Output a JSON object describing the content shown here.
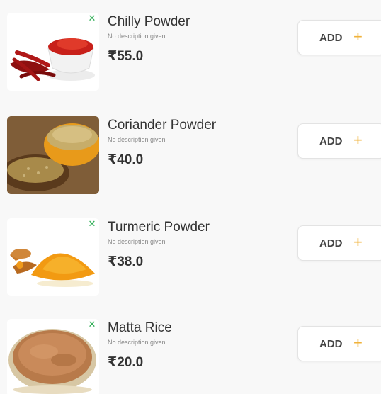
{
  "products": [
    {
      "name": "Chilly Powder",
      "description": "No description given",
      "price": "₹55.0",
      "add_label": "ADD",
      "add_icon": "plus-icon",
      "veg_icon": "veg-indicator-icon"
    },
    {
      "name": "Coriander Powder",
      "description": "No description given",
      "price": "₹40.0",
      "add_label": "ADD",
      "add_icon": "plus-icon"
    },
    {
      "name": "Turmeric Powder",
      "description": "No description given",
      "price": "₹38.0",
      "add_label": "ADD",
      "add_icon": "plus-icon",
      "veg_icon": "veg-indicator-icon"
    },
    {
      "name": "Matta Rice",
      "description": "No description given",
      "price": "₹20.0",
      "add_label": "ADD",
      "add_icon": "plus-icon",
      "veg_icon": "veg-indicator-icon"
    }
  ],
  "colors": {
    "accent_plus": "#f0b23a",
    "veg_green": "#2fae55",
    "text": "#333333",
    "muted": "#888888",
    "background": "#f8f8f8"
  }
}
